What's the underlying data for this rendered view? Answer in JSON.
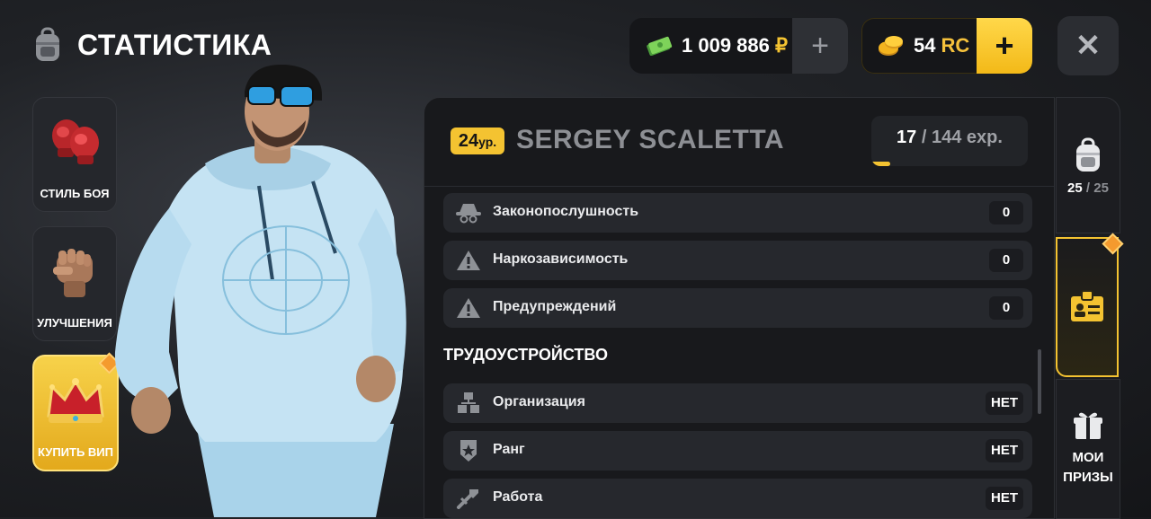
{
  "header": {
    "title": "СТАТИСТИКА",
    "money_value": "1 009 886",
    "money_currency": "₽",
    "gold_value": "54",
    "gold_currency": "RC",
    "plus_label": "+",
    "close_label": "✕"
  },
  "left_nav": {
    "items": [
      {
        "label": "СТИЛЬ БОЯ",
        "icon": "boxing-gloves-icon"
      },
      {
        "label": "УЛУЧШЕНИЯ",
        "icon": "fist-icon"
      },
      {
        "label": "КУПИТЬ ВИП",
        "icon": "crown-icon"
      }
    ]
  },
  "player": {
    "level_num": "24",
    "level_unit": "ур.",
    "name": "SERGEY SCALETTA",
    "exp_current": "17",
    "exp_sep": "/",
    "exp_max": "144 exp.",
    "exp_progress": 0.118
  },
  "stats": [
    {
      "label": "Законопослушность",
      "value": "0",
      "icon": "spy-hat-icon"
    },
    {
      "label": "Наркозависимость",
      "value": "0",
      "icon": "warning-icon"
    },
    {
      "label": "Предупреждений",
      "value": "0",
      "icon": "warning-icon"
    }
  ],
  "employment": {
    "title": "ТРУДОУСТРОЙСТВО",
    "rows": [
      {
        "label": "Организация",
        "value": "НЕТ",
        "icon": "organization-icon"
      },
      {
        "label": "Ранг",
        "value": "НЕТ",
        "icon": "rank-badge-icon"
      },
      {
        "label": "Работа",
        "value": "НЕТ",
        "icon": "work-tools-icon"
      }
    ]
  },
  "right_nav": {
    "inventory_count": "25",
    "inventory_sep": "/",
    "inventory_max": "25",
    "prizes_line1": "МОИ",
    "prizes_line2": "ПРИЗЫ"
  },
  "colors": {
    "accent": "#f4c331",
    "panel": "#18191c",
    "row": "#26282d"
  }
}
